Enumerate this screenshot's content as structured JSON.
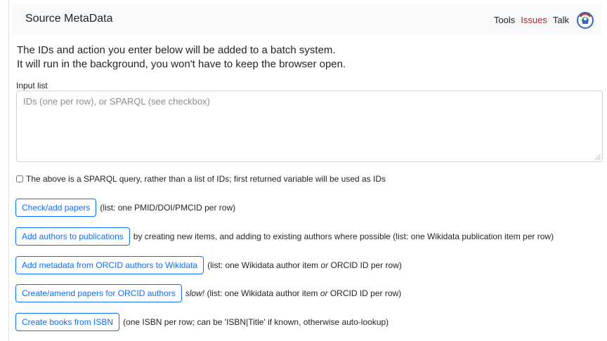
{
  "header": {
    "title": "Source MetaData",
    "links": [
      "Tools",
      "Issues",
      "Talk"
    ]
  },
  "intro": {
    "line1": "The IDs and action you enter below will be added to a batch system.",
    "line2": "It will run in the background, you won't have to keep the browser open."
  },
  "input": {
    "label": "Input list",
    "placeholder": "IDs (one per row), or SPARQL (see checkbox)",
    "value": ""
  },
  "sparql_checkbox": {
    "checked": false,
    "label": "The above is a SPARQL query, rather than a list of IDs; first returned variable will be used as IDs"
  },
  "actions": [
    {
      "button": "Check/add papers",
      "desc": "(list: one PMID/DOI/PMCID per row)"
    },
    {
      "button": "Add authors to publications",
      "desc": "by creating new items, and adding to existing authors where possible (list: one Wikidata publication item per row)"
    },
    {
      "button": "Add metadata from ORCID authors to Wikidata",
      "desc_pre": "(list: one Wikidata author item ",
      "desc_or": "or",
      "desc_post": " ORCID ID per row)"
    },
    {
      "button": "Create/amend papers for ORCID authors",
      "desc_slow": "slow!",
      "desc_pre": " (list: one Wikidata author item ",
      "desc_or": "or",
      "desc_post": " ORCID ID per row)"
    },
    {
      "button": "Create books from ISBN",
      "desc": "(one ISBN per row; can be 'ISBN|Title' if known, otherwise auto-lookup)"
    }
  ],
  "colors": {
    "link_red": "#a52a2a",
    "button_blue": "#0d6efd",
    "navbar_bg": "#f8f9fa"
  }
}
